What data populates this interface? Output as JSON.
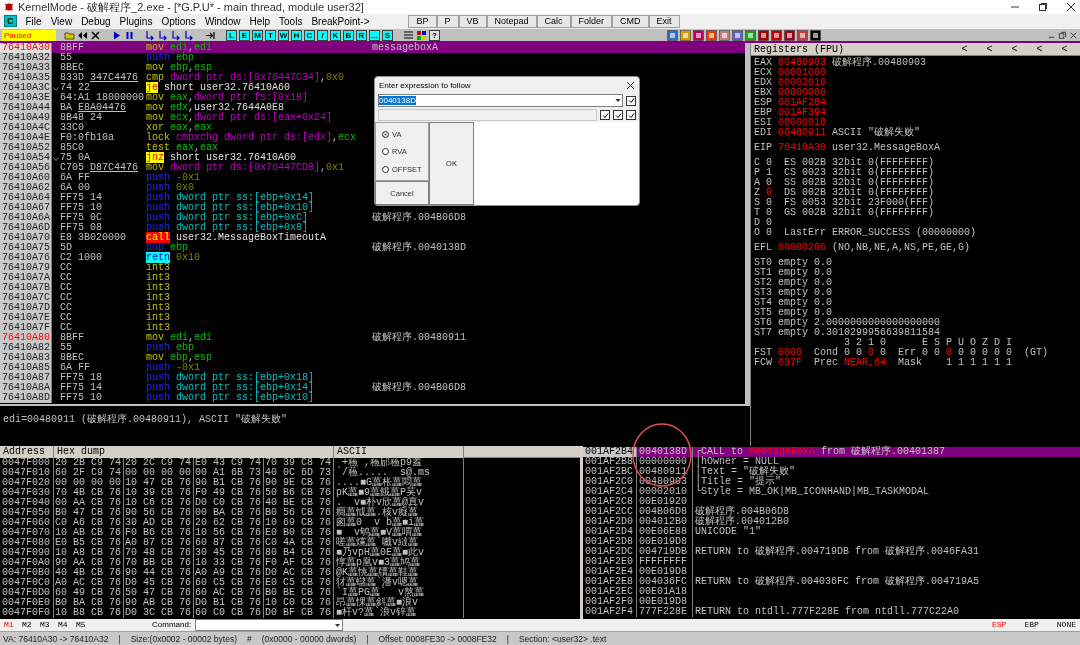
{
  "window": {
    "title": "KernelMode - 破解程序_2.exe - [*G.P.U* - main thread, module user32]"
  },
  "menu": {
    "logo": "C",
    "items": [
      "File",
      "View",
      "Debug",
      "Plugins",
      "Options",
      "Window",
      "Help",
      "Tools",
      "BreakPoint->"
    ],
    "quick_buttons": [
      "BP",
      "P",
      "VB",
      "Notepad",
      "Calc",
      "Folder",
      "CMD",
      "Exit"
    ]
  },
  "toolbar": {
    "status": "Paused",
    "letter_buttons": [
      "L",
      "E",
      "M",
      "T",
      "W",
      "H",
      "C",
      "/",
      "K",
      "B",
      "R",
      "...",
      "S"
    ],
    "help_button": "?"
  },
  "disassembly": {
    "rows": [
      {
        "address": "76410A30",
        "marked": true,
        "selected": true,
        "jump": false,
        "hex": "8BFF",
        "mnemonic": "mov",
        "kind": "plain",
        "ops": [
          {
            "text": "edi",
            "kind": "register"
          },
          {
            "text": ",",
            "kind": "punct"
          },
          {
            "text": "edi",
            "kind": "register"
          }
        ],
        "comment": "messageboxA"
      },
      {
        "address": "76410A32",
        "marked": false,
        "selected": false,
        "jump": false,
        "hex": "55",
        "mnemonic": "push",
        "kind": "stack",
        "ops": [
          {
            "text": "ebp",
            "kind": "register"
          }
        ]
      },
      {
        "address": "76410A33",
        "marked": false,
        "selected": false,
        "jump": false,
        "hex": "8BEC",
        "mnemonic": "mov",
        "kind": "plain",
        "ops": [
          {
            "text": "ebp",
            "kind": "register"
          },
          {
            "text": ",",
            "kind": "punct"
          },
          {
            "text": "esp",
            "kind": "register"
          }
        ]
      },
      {
        "address": "76410A35",
        "marked": false,
        "selected": false,
        "jump": false,
        "hex": "833D",
        "fixup": "347C4476",
        "mnemonic": "cmp",
        "kind": "plain",
        "ops": [
          {
            "text": "dword ptr ds:[0x76447C34]",
            "kind": "memory"
          },
          {
            "text": ",",
            "kind": "punct"
          },
          {
            "text": "0x0",
            "kind": "immediate"
          }
        ]
      },
      {
        "address": "76410A3C",
        "marked": false,
        "selected": false,
        "jump": true,
        "hex": "74 22",
        "mnemonic": "je",
        "kind": "jump",
        "ops": [
          {
            "text": "short user32.76410A60",
            "kind": "symbol"
          }
        ]
      },
      {
        "address": "76410A3E",
        "marked": false,
        "selected": false,
        "jump": false,
        "hex": "64:A1 18000000",
        "mnemonic": "mov",
        "kind": "plain",
        "ops": [
          {
            "text": "eax",
            "kind": "register"
          },
          {
            "text": ",",
            "kind": "punct"
          },
          {
            "text": "dword ptr fs:[0x18]",
            "kind": "memory"
          }
        ]
      },
      {
        "address": "76410A44",
        "marked": false,
        "selected": false,
        "jump": false,
        "hex": "BA",
        "fixup": "E8A04476",
        "mnemonic": "mov",
        "kind": "plain",
        "ops": [
          {
            "text": "edx",
            "kind": "register"
          },
          {
            "text": ",user32.7644A0E8",
            "kind": "symbol"
          }
        ]
      },
      {
        "address": "76410A49",
        "marked": false,
        "selected": false,
        "jump": false,
        "hex": "8B48 24",
        "mnemonic": "mov",
        "kind": "plain",
        "ops": [
          {
            "text": "ecx",
            "kind": "register"
          },
          {
            "text": ",",
            "kind": "punct"
          },
          {
            "text": "dword ptr ds:[eax+0x24]",
            "kind": "memory"
          }
        ]
      },
      {
        "address": "76410A4C",
        "marked": false,
        "selected": false,
        "jump": false,
        "hex": "33C0",
        "mnemonic": "xor",
        "kind": "plain",
        "ops": [
          {
            "text": "eax",
            "kind": "register"
          },
          {
            "text": ",",
            "kind": "punct"
          },
          {
            "text": "eax",
            "kind": "register"
          }
        ]
      },
      {
        "address": "76410A4E",
        "marked": false,
        "selected": false,
        "jump": false,
        "hex": "F0:0fb10a",
        "mnemonic": "lock",
        "kind": "plain",
        "ops": [
          {
            "text": "cmpxchg dword ptr ds:[edx]",
            "kind": "memory"
          },
          {
            "text": ",",
            "kind": "punct"
          },
          {
            "text": "ecx",
            "kind": "register"
          }
        ]
      },
      {
        "address": "76410A52",
        "marked": false,
        "selected": false,
        "jump": false,
        "hex": "85C0",
        "mnemonic": "test",
        "kind": "plain",
        "ops": [
          {
            "text": "eax",
            "kind": "register"
          },
          {
            "text": ",",
            "kind": "punct"
          },
          {
            "text": "eax",
            "kind": "register"
          }
        ]
      },
      {
        "address": "76410A54",
        "marked": false,
        "selected": false,
        "jump": true,
        "hex": "75 0A",
        "mnemonic": "jnz",
        "kind": "jump",
        "ops": [
          {
            "text": "short user32.76410A60",
            "kind": "symbol"
          }
        ]
      },
      {
        "address": "76410A56",
        "marked": false,
        "selected": false,
        "jump": false,
        "hex": "C705",
        "fixup": "D87C4476",
        "mnemonic": "mov",
        "kind": "plain",
        "ops": [
          {
            "text": "dword ptr ds:[0x76447CD8]",
            "kind": "memory"
          },
          {
            "text": ",",
            "kind": "punct"
          },
          {
            "text": "0x1",
            "kind": "immediate"
          }
        ]
      },
      {
        "address": "76410A60",
        "marked": false,
        "selected": false,
        "jump": false,
        "hex": "6A FF",
        "mnemonic": "push",
        "kind": "stack",
        "ops": [
          {
            "text": "-0x1",
            "kind": "immediate"
          }
        ]
      },
      {
        "address": "76410A62",
        "marked": false,
        "selected": false,
        "jump": false,
        "hex": "6A 00",
        "mnemonic": "push",
        "kind": "stack",
        "ops": [
          {
            "text": "0x0",
            "kind": "immediate"
          }
        ]
      },
      {
        "address": "76410A64",
        "marked": false,
        "selected": false,
        "jump": false,
        "hex": "FF75 14",
        "mnemonic": "push",
        "kind": "stack",
        "ops": [
          {
            "text": "dword ptr ss:[ebp+0x14]",
            "kind": "frame"
          }
        ]
      },
      {
        "address": "76410A67",
        "marked": false,
        "selected": false,
        "jump": false,
        "hex": "FF75 10",
        "mnemonic": "push",
        "kind": "stack",
        "ops": [
          {
            "text": "dword ptr ss:[ebp+0x10]",
            "kind": "frame"
          }
        ]
      },
      {
        "address": "76410A6A",
        "marked": false,
        "selected": false,
        "jump": false,
        "hex": "FF75 0C",
        "mnemonic": "push",
        "kind": "stack",
        "ops": [
          {
            "text": "dword ptr ss:[ebp+0xC]",
            "kind": "frame"
          }
        ],
        "comment": "破解程序.004B06D8"
      },
      {
        "address": "76410A6D",
        "marked": false,
        "selected": false,
        "jump": false,
        "hex": "FF75 08",
        "mnemonic": "push",
        "kind": "stack",
        "ops": [
          {
            "text": "dword ptr ss:[ebp+0x8]",
            "kind": "frame"
          }
        ]
      },
      {
        "address": "76410A70",
        "marked": false,
        "selected": false,
        "jump": false,
        "hex": "E8 3B020000",
        "mnemonic": "call",
        "kind": "call",
        "ops": [
          {
            "text": "user32.MessageBoxTimeoutA",
            "kind": "symbol"
          }
        ]
      },
      {
        "address": "76410A75",
        "marked": false,
        "selected": false,
        "jump": false,
        "hex": "5D",
        "mnemonic": "pop",
        "kind": "stack",
        "ops": [
          {
            "text": "ebp",
            "kind": "register"
          }
        ],
        "comment": "破解程序.0040138D"
      },
      {
        "address": "76410A76",
        "marked": false,
        "selected": false,
        "jump": false,
        "hex": "C2 1000",
        "mnemonic": "retn",
        "kind": "ret",
        "ops": [
          {
            "text": "0x10",
            "kind": "immediate"
          }
        ]
      },
      {
        "address": "76410A79",
        "marked": false,
        "selected": false,
        "jump": false,
        "hex": "CC",
        "mnemonic": "int3",
        "kind": "plain",
        "ops": []
      },
      {
        "address": "76410A7A",
        "marked": false,
        "selected": false,
        "jump": false,
        "hex": "CC",
        "mnemonic": "int3",
        "kind": "plain",
        "ops": []
      },
      {
        "address": "76410A7B",
        "marked": false,
        "selected": false,
        "jump": false,
        "hex": "CC",
        "mnemonic": "int3",
        "kind": "plain",
        "ops": []
      },
      {
        "address": "76410A7C",
        "marked": false,
        "selected": false,
        "jump": false,
        "hex": "CC",
        "mnemonic": "int3",
        "kind": "plain",
        "ops": []
      },
      {
        "address": "76410A7D",
        "marked": false,
        "selected": false,
        "jump": false,
        "hex": "CC",
        "mnemonic": "int3",
        "kind": "plain",
        "ops": []
      },
      {
        "address": "76410A7E",
        "marked": false,
        "selected": false,
        "jump": false,
        "hex": "CC",
        "mnemonic": "int3",
        "kind": "plain",
        "ops": []
      },
      {
        "address": "76410A7F",
        "marked": false,
        "selected": false,
        "jump": false,
        "hex": "CC",
        "mnemonic": "int3",
        "kind": "plain",
        "ops": []
      },
      {
        "address": "76410A80",
        "marked": true,
        "selected": false,
        "jump": false,
        "hex": "8BFF",
        "mnemonic": "mov",
        "kind": "plain",
        "ops": [
          {
            "text": "edi",
            "kind": "register"
          },
          {
            "text": ",",
            "kind": "punct"
          },
          {
            "text": "edi",
            "kind": "register"
          }
        ],
        "comment": "破解程序.00480911"
      },
      {
        "address": "76410A82",
        "marked": false,
        "selected": false,
        "jump": false,
        "hex": "55",
        "mnemonic": "push",
        "kind": "stack",
        "ops": [
          {
            "text": "ebp",
            "kind": "register"
          }
        ]
      },
      {
        "address": "76410A83",
        "marked": false,
        "selected": false,
        "jump": false,
        "hex": "8BEC",
        "mnemonic": "mov",
        "kind": "plain",
        "ops": [
          {
            "text": "ebp",
            "kind": "register"
          },
          {
            "text": ",",
            "kind": "punct"
          },
          {
            "text": "esp",
            "kind": "register"
          }
        ]
      },
      {
        "address": "76410A85",
        "marked": false,
        "selected": false,
        "jump": false,
        "hex": "6A FF",
        "mnemonic": "push",
        "kind": "stack",
        "ops": [
          {
            "text": "-0x1",
            "kind": "immediate"
          }
        ]
      },
      {
        "address": "76410A87",
        "marked": false,
        "selected": false,
        "jump": false,
        "hex": "FF75 18",
        "mnemonic": "push",
        "kind": "stack",
        "ops": [
          {
            "text": "dword ptr ss:[ebp+0x18]",
            "kind": "frame"
          }
        ]
      },
      {
        "address": "76410A8A",
        "marked": false,
        "selected": false,
        "jump": false,
        "hex": "FF75 14",
        "mnemonic": "push",
        "kind": "stack",
        "ops": [
          {
            "text": "dword ptr ss:[ebp+0x14]",
            "kind": "frame"
          }
        ],
        "comment": "破解程序.004B06D8"
      },
      {
        "address": "76410A8D",
        "marked": false,
        "selected": false,
        "jump": false,
        "hex": "FF75 10",
        "mnemonic": "push",
        "kind": "stack",
        "ops": [
          {
            "text": "dword ptr ss:[ebp+0x10]",
            "kind": "frame"
          }
        ]
      }
    ]
  },
  "info_line": "edi=00480911 (破解程序.00480911), ASCII \"破解失败\"",
  "registers": {
    "title": "Registers (FPU)",
    "arrows": [
      "<",
      "<",
      "<",
      "<",
      "<"
    ],
    "groups": [
      [
        [
          {
            "text": "EAX ",
            "kind": "normal"
          },
          {
            "text": "00480903",
            "kind": "changed"
          },
          {
            "text": " 破解程序.00480903",
            "kind": "normal"
          }
        ],
        [
          {
            "text": "ECX ",
            "kind": "normal"
          },
          {
            "text": "00001000",
            "kind": "changed"
          }
        ],
        [
          {
            "text": "EDX ",
            "kind": "normal"
          },
          {
            "text": "00002010",
            "kind": "changed"
          }
        ],
        [
          {
            "text": "EBX ",
            "kind": "normal"
          },
          {
            "text": "00000000",
            "kind": "changed"
          }
        ],
        [
          {
            "text": "ESP ",
            "kind": "normal"
          },
          {
            "text": "001AF284",
            "kind": "changed"
          }
        ],
        [
          {
            "text": "EBP ",
            "kind": "normal"
          },
          {
            "text": "001AF394",
            "kind": "changed"
          }
        ],
        [
          {
            "text": "ESI ",
            "kind": "normal"
          },
          {
            "text": "00000010",
            "kind": "changed"
          }
        ],
        [
          {
            "text": "EDI ",
            "kind": "normal"
          },
          {
            "text": "00480911",
            "kind": "changed"
          },
          {
            "text": " ASCII \"破解失败\"",
            "kind": "normal"
          }
        ]
      ],
      [
        [
          {
            "text": "EIP ",
            "kind": "normal"
          },
          {
            "text": "76410A30",
            "kind": "changed"
          },
          {
            "text": " user32.MessageBoxA",
            "kind": "normal"
          }
        ]
      ],
      [
        [
          {
            "text": "C 0  ES 002B 32bit 0(FFFFFFFF)",
            "kind": "normal"
          }
        ],
        [
          {
            "text": "P 1  CS 0023 32bit 0(FFFFFFFF)",
            "kind": "normal"
          }
        ],
        [
          {
            "text": "A 0  SS 002B 32bit 0(FFFFFFFF)",
            "kind": "normal"
          }
        ],
        [
          {
            "text": "Z ",
            "kind": "normal"
          },
          {
            "text": "0",
            "kind": "changed"
          },
          {
            "text": "  DS 002B 32bit 0(FFFFFFFF)",
            "kind": "normal"
          }
        ],
        [
          {
            "text": "S 0  FS 0053 32bit 23F000(FFF)",
            "kind": "normal"
          }
        ],
        [
          {
            "text": "T 0  GS 002B 32bit 0(FFFFFFFF)",
            "kind": "normal"
          }
        ],
        [
          {
            "text": "D 0",
            "kind": "normal"
          }
        ],
        [
          {
            "text": "O 0  LastErr ERROR_SUCCESS (00000000)",
            "kind": "normal"
          }
        ]
      ],
      [
        [
          {
            "text": "EFL ",
            "kind": "normal"
          },
          {
            "text": "00000206",
            "kind": "changed"
          },
          {
            "text": " (NO,NB,NE,A,NS,PE,GE,G)",
            "kind": "normal"
          }
        ]
      ],
      [
        [
          {
            "text": "ST0 empty 0.0",
            "kind": "normal"
          }
        ],
        [
          {
            "text": "ST1 empty 0.0",
            "kind": "normal"
          }
        ],
        [
          {
            "text": "ST2 empty 0.0",
            "kind": "normal"
          }
        ],
        [
          {
            "text": "ST3 empty 0.0",
            "kind": "normal"
          }
        ],
        [
          {
            "text": "ST4 empty 0.0",
            "kind": "normal"
          }
        ],
        [
          {
            "text": "ST5 empty 0.0",
            "kind": "normal"
          }
        ],
        [
          {
            "text": "ST6 empty 2.0000000000000000000",
            "kind": "normal"
          }
        ],
        [
          {
            "text": "ST7 empty 0.3010299956639811584",
            "kind": "normal"
          }
        ],
        [
          {
            "text": "               3 2 1 0      E S P U O Z D I",
            "kind": "normal"
          }
        ],
        [
          {
            "text": "FST ",
            "kind": "normal"
          },
          {
            "text": "0000",
            "kind": "changed"
          },
          {
            "text": "  Cond 0 0 ",
            "kind": "normal"
          },
          {
            "text": "0",
            "kind": "changed"
          },
          {
            "text": " 0  Err 0 0 ",
            "kind": "normal"
          },
          {
            "text": "0",
            "kind": "changed"
          },
          {
            "text": " 0 0 0 0 0  (GT)",
            "kind": "normal"
          }
        ],
        [
          {
            "text": "FCW ",
            "kind": "normal"
          },
          {
            "text": "037F",
            "kind": "changed"
          },
          {
            "text": "  Prec ",
            "kind": "normal"
          },
          {
            "text": "NEAR,64",
            "kind": "changed"
          },
          {
            "text": "  Mask    1 1 1 1 1 1",
            "kind": "normal"
          }
        ]
      ]
    ]
  },
  "dialog": {
    "title": "Enter expression to follow",
    "value": "0040138D",
    "checkboxes_top": [
      {
        "checked": true
      }
    ],
    "checkboxes_bottom": [
      {
        "checked": true
      },
      {
        "checked": true
      },
      {
        "checked": true
      }
    ],
    "options": [
      {
        "label": "VA",
        "selected": true
      },
      {
        "label": "RVA",
        "selected": false
      },
      {
        "label": "OFFSET",
        "selected": false
      }
    ],
    "ok": "OK",
    "cancel": "Cancel"
  },
  "hex_dump": {
    "columns": [
      "Address",
      "Hex dump",
      "ASCII"
    ],
    "rows": [
      {
        "address": "0047F000",
        "groups": [
          "20 2B C9 74",
          "20 2C C9 74",
          "E0 43 C9 74",
          "70 39 C8 74"
        ],
        "ascii": " +蘓 ,蘓郈蘓p9蓋"
      },
      {
        "address": "0047F010",
        "groups": [
          "60 2F C9 74",
          "00 00 00 00",
          "00 A1 6B 73",
          "40 0C 6D 73"
        ],
        "ascii": "`/蘓.....  s@.ms"
      },
      {
        "address": "0047F020",
        "groups": [
          "00 00 00 00",
          "10 47 CB 76",
          "90 B1 CB 76",
          "90 9E CB 76"
        ],
        "ascii": "....■G藟枨藟悶藟"
      },
      {
        "address": "0047F030",
        "groups": [
          "70 4B CB 76",
          "10 39 CB 76",
          "F0 49 CB 76",
          "50 B6 CB 76"
        ],
        "ascii": "pK藟■9藟餓藟P芺v"
      },
      {
        "address": "0047F040",
        "groups": [
          "00 AA CB 76",
          "10 C6 CB 76",
          "D0 C0 CB 76",
          "40 BE CB 76"
        ],
        "ascii": ".  v■朴v欣藟@真v"
      },
      {
        "address": "0047F050",
        "groups": [
          "B0 47 CB 76",
          "90 56 CB 76",
          "00 BA CB 76",
          "B0 56 CB 76"
        ],
        "ascii": "癎藟怴藟.核v癡藟"
      },
      {
        "address": "0047F060",
        "groups": [
          "C0 A6 CB 76",
          "30 AD CB 76",
          "20 62 CB 76",
          "10 69 CB 76"
        ],
        "ascii": "囪藟0  v b藟■i藟"
      },
      {
        "address": "0047F070",
        "groups": [
          "10 AB CB 76",
          "F0 B6 CB 76",
          "10 56 CB 76",
          "E0 B0 CB 76"
        ],
        "ascii": "■  v鸲藟■V藟喟藟"
      },
      {
        "address": "0047F080",
        "groups": [
          "E0 B5 CB 76",
          "A0 87 CB 76",
          "60 87 CB 76",
          "C0 4A CB 76"
        ],
        "ascii": "嗟藟爣藟`嚱v繨藟"
      },
      {
        "address": "0047F090",
        "groups": [
          "10 A8 CB 76",
          "70 48 CB 76",
          "30 45 CB 76",
          "80 B4 CB 76"
        ],
        "ascii": "■乃vpH藟0E藟■此v"
      },
      {
        "address": "0047F0A0",
        "groups": [
          "90 AA CB 76",
          "70 BB CB 76",
          "10 33 CB 76",
          "F0 AF CB 76"
        ],
        "ascii": "惇藟p凰v■3藟鸠藟"
      },
      {
        "address": "0047F0B0",
        "groups": [
          "40 4B CB 76",
          "90 44 CB 76",
          "A0 A9 CB 76",
          "D0 AC CB 76"
        ],
        "ascii": "@K藟恌藟牘藟鞋藟"
      },
      {
        "address": "0047F0C0",
        "groups": [
          "A0 AC CB 76",
          "D0 45 CB 76",
          "60 C5 CB 76",
          "E0 C5 CB 76"
        ],
        "ascii": "犲藟蠩藟`潘v嗯藟"
      },
      {
        "address": "0047F0D0",
        "groups": [
          "60 49 CB 76",
          "50 47 CB 76",
          "60 AC CB 76",
          "B0 BE CB 76"
        ],
        "ascii": "`I藟PG藟`  v熬藟"
      },
      {
        "address": "0047F0E0",
        "groups": [
          "B0 BA CB 76",
          "90 AB CB 76",
          "D0 B1 CB 76",
          "10 C0 CB 76"
        ],
        "ascii": "昂藟惈藟斜藟■浪v"
      },
      {
        "address": "0047F0F0",
        "groups": [
          "10 B8 CB 76",
          "D0 3C CB 76",
          "60 C0 CB 76",
          "D0 BF CB 76"
        ],
        "ascii": "■杆v?藟`浪v锌藟"
      }
    ]
  },
  "stack": {
    "rows": [
      {
        "address": "001AF2B4",
        "value": "0040138D",
        "selected": true,
        "comment": [
          {
            "text": "┌CALL to ",
            "kind": "normal"
          },
          {
            "text": "MessageBoxA",
            "kind": "changed"
          },
          {
            "text": " from 破解程序.00401387",
            "kind": "normal"
          }
        ]
      },
      {
        "address": "001AF2B8",
        "value": "00000000",
        "selected": false,
        "comment": [
          {
            "text": "│hOwner = NULL",
            "kind": "normal"
          }
        ]
      },
      {
        "address": "001AF2BC",
        "value": "00480911",
        "selected": false,
        "comment": [
          {
            "text": "│Text = \"破解失败\"",
            "kind": "normal"
          }
        ]
      },
      {
        "address": "001AF2C0",
        "value": "00480903",
        "selected": false,
        "comment": [
          {
            "text": "│Title = \"提示\"",
            "kind": "normal"
          }
        ]
      },
      {
        "address": "001AF2C4",
        "value": "00002010",
        "selected": false,
        "comment": [
          {
            "text": "└Style = MB_OK|MB_ICONHAND|MB_TASKMODAL",
            "kind": "normal"
          }
        ]
      },
      {
        "address": "001AF2C8",
        "value": "00E01920",
        "selected": false,
        "comment": []
      },
      {
        "address": "001AF2CC",
        "value": "004B06D8",
        "selected": false,
        "comment": [
          {
            "text": "破解程序.004B06D8",
            "kind": "normal"
          }
        ]
      },
      {
        "address": "001AF2D0",
        "value": "004012B0",
        "selected": false,
        "comment": [
          {
            "text": "破解程序.004012B0",
            "kind": "normal"
          }
        ]
      },
      {
        "address": "001AF2D4",
        "value": "00E06E88",
        "selected": false,
        "comment": [
          {
            "text": "UNICODE \"1\"",
            "kind": "normal"
          }
        ]
      },
      {
        "address": "001AF2D8",
        "value": "00E019D8",
        "selected": false,
        "comment": []
      },
      {
        "address": "001AF2DC",
        "value": "004719DB",
        "selected": false,
        "comment": [
          {
            "text": "RETURN to 破解程序.004719DB from 破解程序.0046FA31",
            "kind": "normal"
          }
        ]
      },
      {
        "address": "001AF2E0",
        "value": "FFFFFFFF",
        "selected": false,
        "comment": []
      },
      {
        "address": "001AF2E4",
        "value": "00E019D8",
        "selected": false,
        "comment": []
      },
      {
        "address": "001AF2E8",
        "value": "004036FC",
        "selected": false,
        "comment": [
          {
            "text": "RETURN to 破解程序.004036FC from 破解程序.004719A5",
            "kind": "normal"
          }
        ]
      },
      {
        "address": "001AF2EC",
        "value": "00E01A18",
        "selected": false,
        "comment": []
      },
      {
        "address": "001AF2F0",
        "value": "00E019D8",
        "selected": false,
        "comment": []
      },
      {
        "address": "001AF2F4",
        "value": "777F228E",
        "selected": false,
        "comment": [
          {
            "text": "RETURN to ntdll.777F228E from ntdll.777C22A0",
            "kind": "normal"
          }
        ]
      }
    ],
    "modes": [
      {
        "label": "ESP",
        "selected": true
      },
      {
        "label": "EBP",
        "selected": false
      },
      {
        "label": "NONE",
        "selected": false
      }
    ]
  },
  "bottom_bar": {
    "marks": [
      {
        "label": "M1",
        "selected": true
      },
      {
        "label": "M2",
        "selected": false
      },
      {
        "label": "M3",
        "selected": false
      },
      {
        "label": "M4",
        "selected": false
      },
      {
        "label": "M5",
        "selected": false
      }
    ],
    "command_label": "Command:"
  },
  "status_bar": [
    "VA: 76410A30 -> 76410A32",
    "|",
    "Size:(0x0002 - 00002 bytes)",
    "#",
    "(0x0000 - 00000 dwords)",
    "|",
    "Offset: 0008FE30 -> 0008FE32",
    "|",
    "Section: <user32> .text"
  ]
}
